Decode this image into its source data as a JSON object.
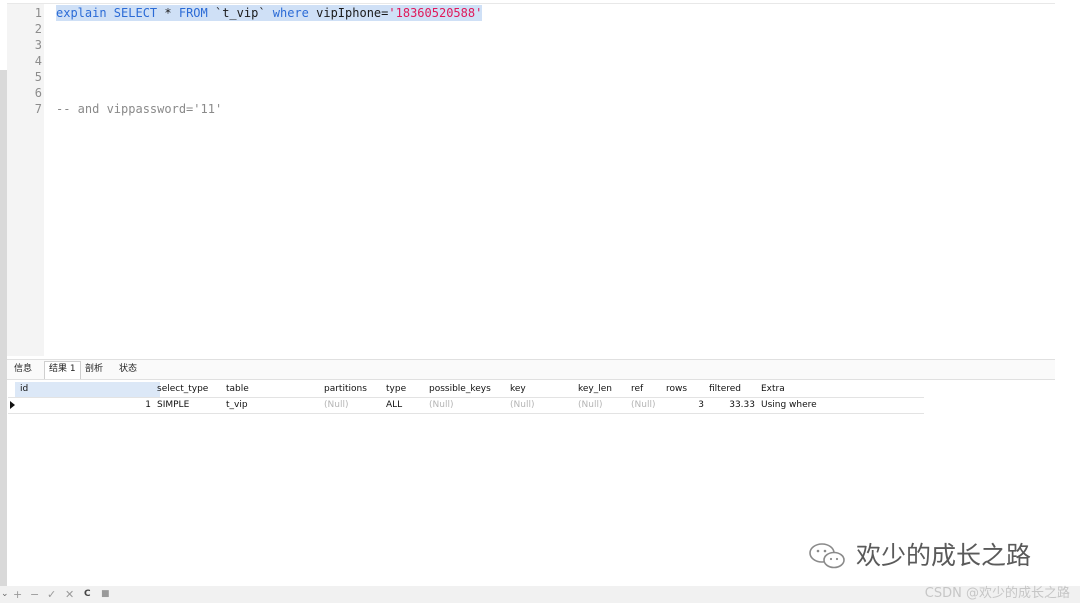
{
  "editor": {
    "lines": [
      {
        "num": "1",
        "parts": [
          [
            "kw",
            "explain SELECT"
          ],
          [
            "plain",
            " * "
          ],
          [
            "kw",
            "FROM"
          ],
          [
            "plain",
            " `t_vip` "
          ],
          [
            "kw",
            "where"
          ],
          [
            "plain",
            " vipIphone="
          ],
          [
            "str",
            "'18360520588'"
          ]
        ]
      },
      {
        "num": "2",
        "parts": []
      },
      {
        "num": "3",
        "parts": []
      },
      {
        "num": "4",
        "parts": []
      },
      {
        "num": "5",
        "parts": []
      },
      {
        "num": "6",
        "parts": []
      },
      {
        "num": "7",
        "parts": [
          [
            "cmt",
            "-- and vippassword='11'"
          ]
        ]
      }
    ]
  },
  "tabs": [
    "信息",
    "结果 1",
    "剖析",
    "状态"
  ],
  "active_tab": "结果 1",
  "result": {
    "columns": [
      "id",
      "select_type",
      "table",
      "partitions",
      "type",
      "possible_keys",
      "key",
      "key_len",
      "ref",
      "rows",
      "filtered",
      "Extra"
    ],
    "row": [
      "1",
      "SIMPLE",
      "t_vip",
      "(Null)",
      "ALL",
      "(Null)",
      "(Null)",
      "(Null)",
      "(Null)",
      "3",
      "33.33",
      "Using where"
    ]
  },
  "bottom_icons": [
    "add-icon",
    "remove-icon",
    "check-icon",
    "cancel-icon",
    "refresh-icon",
    "stop-icon"
  ],
  "bottom_glyphs": [
    "+",
    "−",
    "✓",
    "✕",
    "C",
    "■"
  ],
  "watermark": "欢少的成长之路",
  "csdn_mark": "CSDN @欢少的成长之路",
  "colors": {
    "keyword": "#2b6bd6",
    "string": "#e0185a",
    "selection": "#cfe0f6"
  }
}
